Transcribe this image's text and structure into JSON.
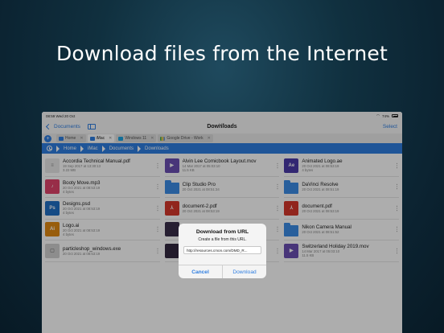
{
  "headline": "Download files from the Internet",
  "status": {
    "time": "08:59",
    "date": "Wed 20 Oct",
    "battery": "74%"
  },
  "nav": {
    "back_label": "Documents",
    "title": "Downloads",
    "select_label": "Select"
  },
  "tabs": [
    {
      "label": "Home",
      "icon": "house-icon"
    },
    {
      "label": "iMac",
      "icon": "monitor-icon"
    },
    {
      "label": "Windows 11",
      "icon": "windows-icon"
    },
    {
      "label": "Google Drive - Work",
      "icon": "drive-icon"
    }
  ],
  "breadcrumb": [
    "Home",
    "iMac",
    "Documents",
    "Downloads"
  ],
  "files": [
    {
      "name": "Accordia Technical Manual.pdf",
      "date": "19 Sep 2017 at 13:30:13",
      "size": "3.22 MB",
      "kind": "document",
      "color": "#e8e8e8"
    },
    {
      "name": "Alvin Lee Comicbook Layout.mov",
      "date": "14 Mar 2017 at 05:03:10",
      "size": "11.5 KB",
      "kind": "movie",
      "color": "#6a4fb3"
    },
    {
      "name": "Animated Logo.ae",
      "date": "20 Oct 2021 at 08:53:19",
      "size": "4 bytes",
      "kind": "ae",
      "color": "#4b3aa8",
      "badge": "Ae"
    },
    {
      "name": "Booty Move.mp3",
      "date": "20 Oct 2021 at 08:53:19",
      "size": "4 bytes",
      "kind": "music",
      "color": "#e0436a"
    },
    {
      "name": "Clip Studio Pro",
      "date": "20 Oct 2021 at 08:51:34",
      "size": "",
      "kind": "folder",
      "color": "#3b8ce6"
    },
    {
      "name": "DaVinci Resolve",
      "date": "20 Oct 2021 at 08:51:19",
      "size": "",
      "kind": "folder",
      "color": "#3b8ce6"
    },
    {
      "name": "Designs.psd",
      "date": "20 Oct 2021 at 08:53:19",
      "size": "4 bytes",
      "kind": "ps",
      "color": "#1f6fc4",
      "badge": "Ps"
    },
    {
      "name": "document-2.pdf",
      "date": "20 Oct 2021 at 08:53:19",
      "size": "",
      "kind": "pdf",
      "color": "#d6372b"
    },
    {
      "name": "document.pdf",
      "date": "20 Oct 2021 at 08:53:19",
      "size": "",
      "kind": "pdf",
      "color": "#d6372b"
    },
    {
      "name": "Logo.ai",
      "date": "20 Oct 2021 at 08:53:19",
      "size": "4 bytes",
      "kind": "ai",
      "color": "#e08a12",
      "badge": "Ai"
    },
    {
      "name": "",
      "date": "",
      "size": "",
      "kind": "image",
      "color": "#3a2f4a"
    },
    {
      "name": "Nikon Camera Manual",
      "date": "20 Oct 2021 at 08:51:52",
      "size": "",
      "kind": "folder",
      "color": "#3b8ce6"
    },
    {
      "name": "particleshop_windows.exe",
      "date": "20 Oct 2021 at 08:53:19",
      "size": "",
      "kind": "exe",
      "color": "#d0d0d0"
    },
    {
      "name": "",
      "date": "",
      "size": "",
      "kind": "image",
      "color": "#332840"
    },
    {
      "name": "Switzerland Holiday 2019.mov",
      "date": "14 Mar 2017 at 05:03:10",
      "size": "11.5 KB",
      "kind": "movie",
      "color": "#6a4fb3"
    }
  ],
  "dialog": {
    "title": "Download from URL",
    "message": "Create a file from this URL.",
    "url_value": "http://resources.cmon.com/DMD_R...",
    "cancel_label": "Cancel",
    "download_label": "Download"
  }
}
